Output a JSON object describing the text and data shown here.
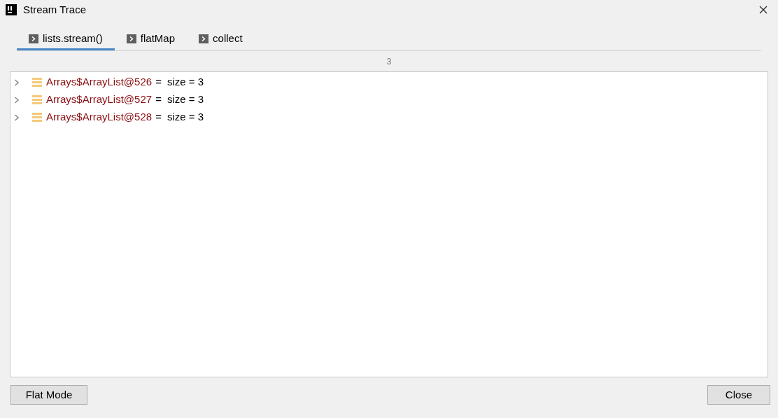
{
  "window": {
    "title": "Stream Trace"
  },
  "tabs": [
    {
      "label": "lists.stream()",
      "selected": true
    },
    {
      "label": "flatMap",
      "selected": false
    },
    {
      "label": "collect",
      "selected": false
    }
  ],
  "count": "3",
  "tree": [
    {
      "name": "Arrays$ArrayList@526",
      "equals": "=",
      "value": "size = 3",
      "expanded": false
    },
    {
      "name": "Arrays$ArrayList@527",
      "equals": "=",
      "value": "size = 3",
      "expanded": false
    },
    {
      "name": "Arrays$ArrayList@528",
      "equals": "=",
      "value": "size = 3",
      "expanded": false
    }
  ],
  "buttons": {
    "left": "Flat Mode",
    "right": "Close"
  }
}
